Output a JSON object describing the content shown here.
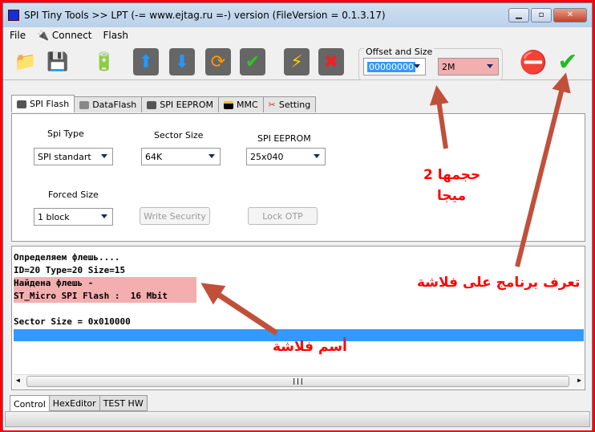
{
  "window": {
    "title": "SPI Tiny Tools >> LPT (-= www.ejtag.ru =-) version (FileVersion = 0.1.3.17)"
  },
  "menu": [
    "File",
    "Connect",
    "Flash"
  ],
  "toolbar": {
    "icons": [
      "open-folder-icon",
      "save-icon",
      "battery-plug-icon",
      "read-up-icon",
      "write-down-icon",
      "verify-cycle-icon",
      "check-icon",
      "flash-bolt-icon",
      "erase-x-icon"
    ],
    "offset_group_label": "Offset and Size",
    "offset_value": "00000000",
    "size_value": "2M",
    "stop_icon": "stop-icon",
    "ok_icon": "green-check-icon"
  },
  "tabs": [
    "SPI Flash",
    "DataFlash",
    "SPI EEPROM",
    "MMC",
    "Setting"
  ],
  "panel": {
    "spi_type_label": "Spi Type",
    "spi_type_value": "SPI standart",
    "sector_size_label": "Sector Size",
    "sector_size_value": "64K",
    "eeprom_label": "SPI EEPROM",
    "eeprom_value": "25x040",
    "forced_size_label": "Forced Size",
    "forced_size_value": "1 block",
    "write_security": "Write Security",
    "lock_otp": "Lock OTP"
  },
  "log": [
    "Определяем флешь....",
    "ID=20 Type=20 Size=15",
    "Найдена флешь -",
    "ST_Micro SPI Flash :  16 Mbit",
    "",
    "Sector Size = 0x010000"
  ],
  "bottom_tabs": [
    "Control",
    "HexEditor",
    "TEST HW"
  ],
  "annotations": {
    "size": "حجمها 2",
    "size2": "ميجا",
    "detect": "تعرف برنامج على فلاشة",
    "name": "أسم فلاشة",
    "color": "#ff0000"
  }
}
